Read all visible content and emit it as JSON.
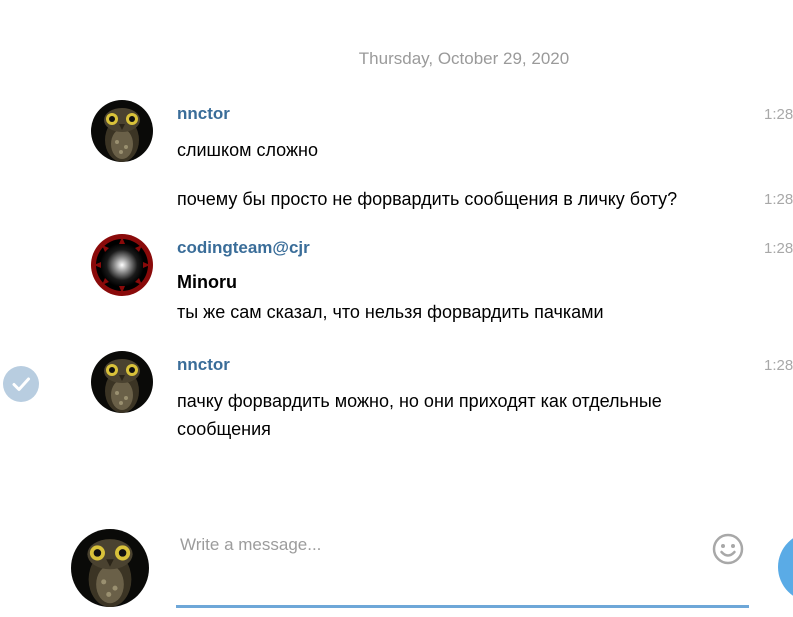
{
  "date_separator": "Thursday, October 29, 2020",
  "messages": [
    {
      "sender": "nnctor",
      "avatar_icon": "owl-avatar-icon",
      "lines": [
        {
          "text": "слишком сложно",
          "time": "1:28"
        },
        {
          "text": "почему бы просто не форвардить сообщения в личку боту?",
          "time": "1:28"
        }
      ]
    },
    {
      "sender": "codingteam@cjr",
      "avatar_icon": "red-sawblade-avatar-icon",
      "forwarded_name": "Minoru",
      "text": "ты же сам сказал, что нельзя форвардить пачками",
      "time": "1:28"
    },
    {
      "sender": "nnctor",
      "avatar_icon": "owl-avatar-icon",
      "selected": true,
      "text": "пачку форвардить можно, но они приходят как отдельные сообщения",
      "time": "1:28"
    }
  ],
  "compose": {
    "placeholder": "Write a message...",
    "value": "",
    "emoji_icon": "smiley-icon",
    "send_icon": "send-icon"
  },
  "colors": {
    "sender_name": "#3a6d99",
    "accent": "#5aabe6",
    "input_underline": "#6ea7d8",
    "selection_check": "#b8cde0",
    "muted_text": "#9a9a9a"
  }
}
